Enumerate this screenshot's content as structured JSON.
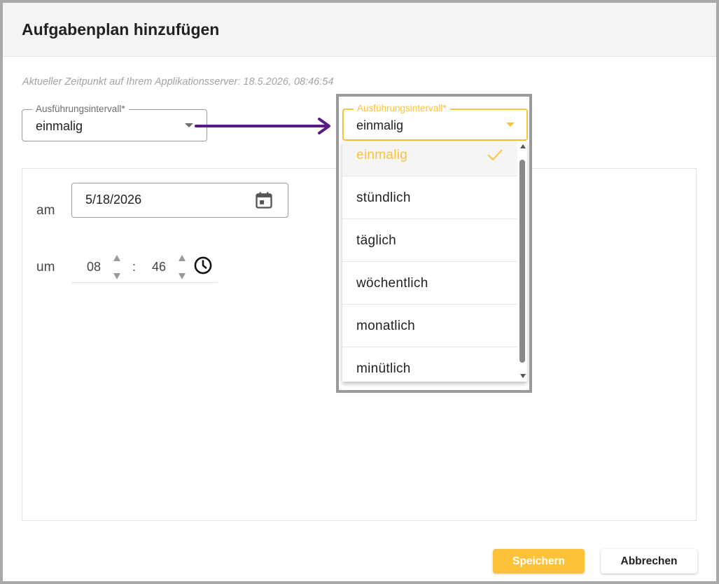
{
  "dialog": {
    "title": "Aufgabenplan hinzufügen",
    "server_time": "Aktueller Zeitpunkt auf Ihrem Applikationsserver: 18.5.2026, 08:46:54"
  },
  "interval_select": {
    "label": "Ausführungsintervall*",
    "value": "einmalig"
  },
  "interval_select_open": {
    "label": "Ausführungsintervall*",
    "value": "einmalig",
    "options": [
      "einmalig",
      "stündlich",
      "täglich",
      "wöchentlich",
      "monatlich",
      "minütlich"
    ],
    "selected_index": 0
  },
  "schedule": {
    "date_label": "am",
    "date_value": "5/18/2026",
    "time_label": "um",
    "hour": "08",
    "separator": ":",
    "minute": "46"
  },
  "buttons": {
    "save": "Speichern",
    "cancel": "Abbrechen"
  },
  "colors": {
    "accent": "#fbc23a",
    "annotation_arrow": "#5b1a86",
    "callout_border": "#9a9a9a"
  },
  "icons": [
    "chevron-down-icon",
    "calendar-icon",
    "clock-icon",
    "check-icon",
    "arrow-right-icon"
  ]
}
